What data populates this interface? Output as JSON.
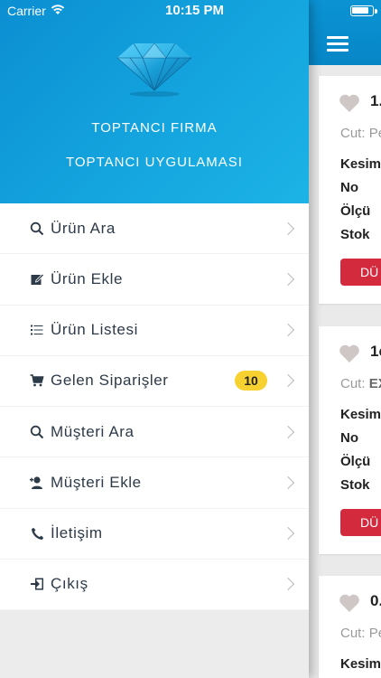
{
  "status_bar": {
    "carrier": "Carrier",
    "time": "10:15 PM"
  },
  "drawer": {
    "brand_line1": "TOPTANCI FIRMA",
    "brand_line2": "TOPTANCI UYGULAMASI",
    "menu": [
      {
        "label": "Ürün Ara",
        "icon": "search-icon"
      },
      {
        "label": "Ürün Ekle",
        "icon": "edit-icon"
      },
      {
        "label": "Ürün Listesi",
        "icon": "list-icon"
      },
      {
        "label": "Gelen Siparişler",
        "icon": "cart-icon",
        "badge": "10"
      },
      {
        "label": "Müşteri Ara",
        "icon": "search-icon"
      },
      {
        "label": "Müşteri Ekle",
        "icon": "user-add-icon"
      },
      {
        "label": "İletişim",
        "icon": "phone-icon"
      },
      {
        "label": "Çıkış",
        "icon": "logout-icon"
      }
    ]
  },
  "cards": [
    {
      "title": "1.",
      "cut_label": "Cut:",
      "cut_value": "Pe",
      "rows": [
        "Kesim",
        "No",
        "Ölçü",
        "Stok"
      ],
      "button": "DÜ"
    },
    {
      "title": "1c",
      "cut_label": "Cut:",
      "cut_value": "EX",
      "rows": [
        "Kesim",
        "No",
        "Ölçü",
        "Stok"
      ],
      "button": "DÜ"
    },
    {
      "title": "0.",
      "cut_label": "Cut:",
      "cut_value": "Pe",
      "rows": [
        "Kesim"
      ]
    }
  ],
  "colors": {
    "header_blue": "#0b8fd2",
    "badge_yellow": "#f7d12f",
    "button_red": "#d42a3e",
    "heart_gray": "#cfc6c6"
  }
}
